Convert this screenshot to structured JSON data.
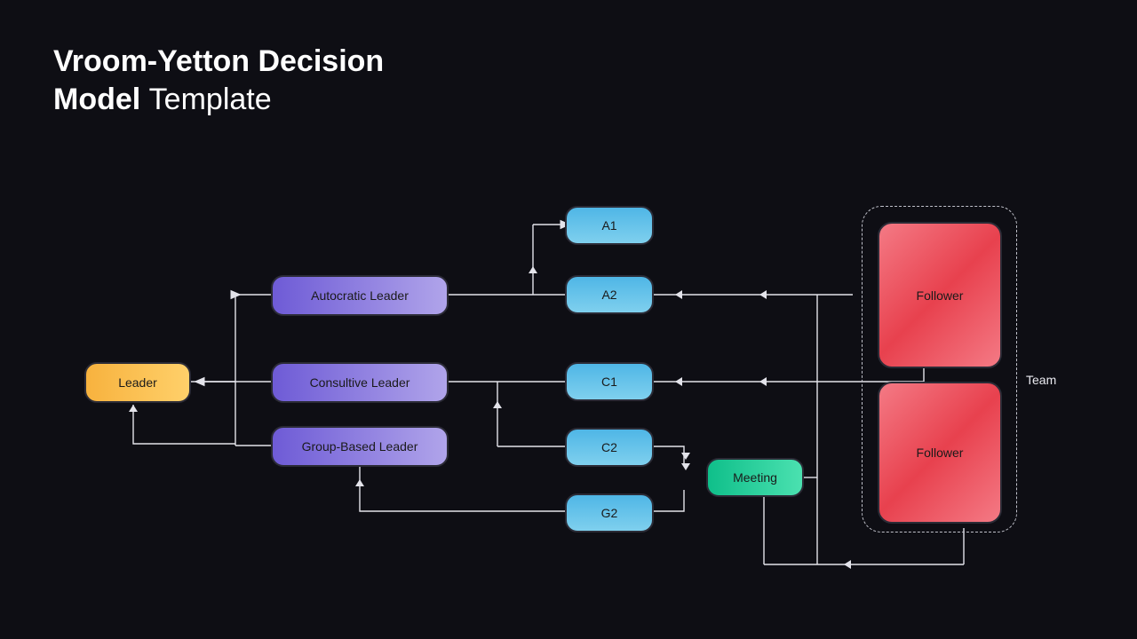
{
  "title": {
    "line1": "Vroom-Yetton Decision",
    "line2_bold": "Model",
    "line2_thin": "Template"
  },
  "nodes": {
    "leader": "Leader",
    "autocratic": "Autocratic Leader",
    "consultive": "Consultive Leader",
    "groupbased": "Group-Based Leader",
    "a1": "A1",
    "a2": "A2",
    "c1": "C1",
    "c2": "C2",
    "g2": "G2",
    "meeting": "Meeting",
    "follower1": "Follower",
    "follower2": "Follower"
  },
  "labels": {
    "team": "Team"
  }
}
